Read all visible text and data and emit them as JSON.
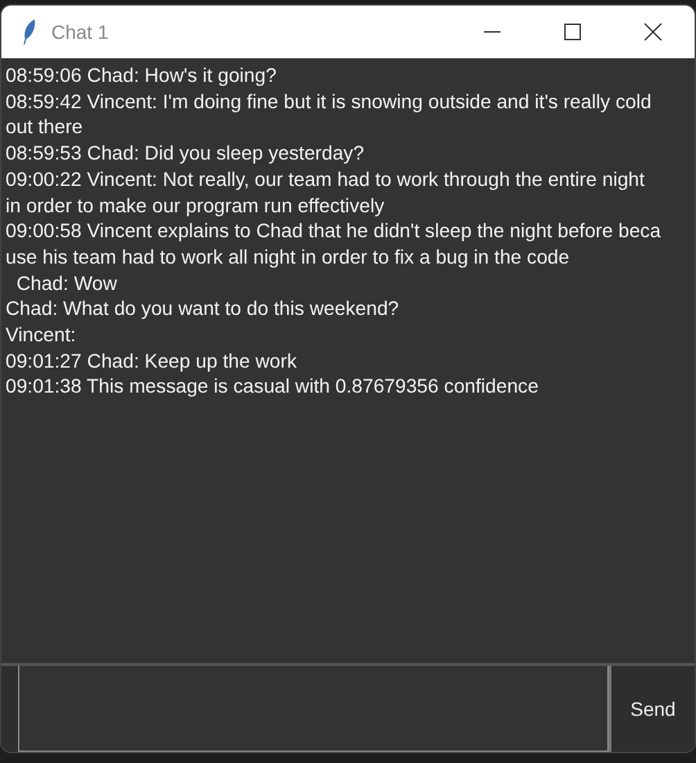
{
  "window": {
    "title": "Chat 1"
  },
  "chat_log": {
    "lines": [
      "08:59:06 Chad: How's it going?",
      "08:59:42 Vincent: I'm doing fine but it is snowing outside and it's really cold",
      "out there",
      "08:59:53 Chad: Did you sleep yesterday?",
      "09:00:22 Vincent: Not really, our team had to work through the entire night",
      "in order to make our program run effectively",
      "09:00:58 Vincent explains to Chad that he didn't sleep the night before beca",
      "use his team had to work all night in order to fix a bug in the code",
      "  Chad: Wow",
      "Chad: What do you want to do this weekend?",
      "Vincent:",
      "09:01:27 Chad: Keep up the work",
      "09:01:38 This message is casual with 0.87679356 confidence"
    ]
  },
  "send_button": {
    "label": "Send"
  }
}
